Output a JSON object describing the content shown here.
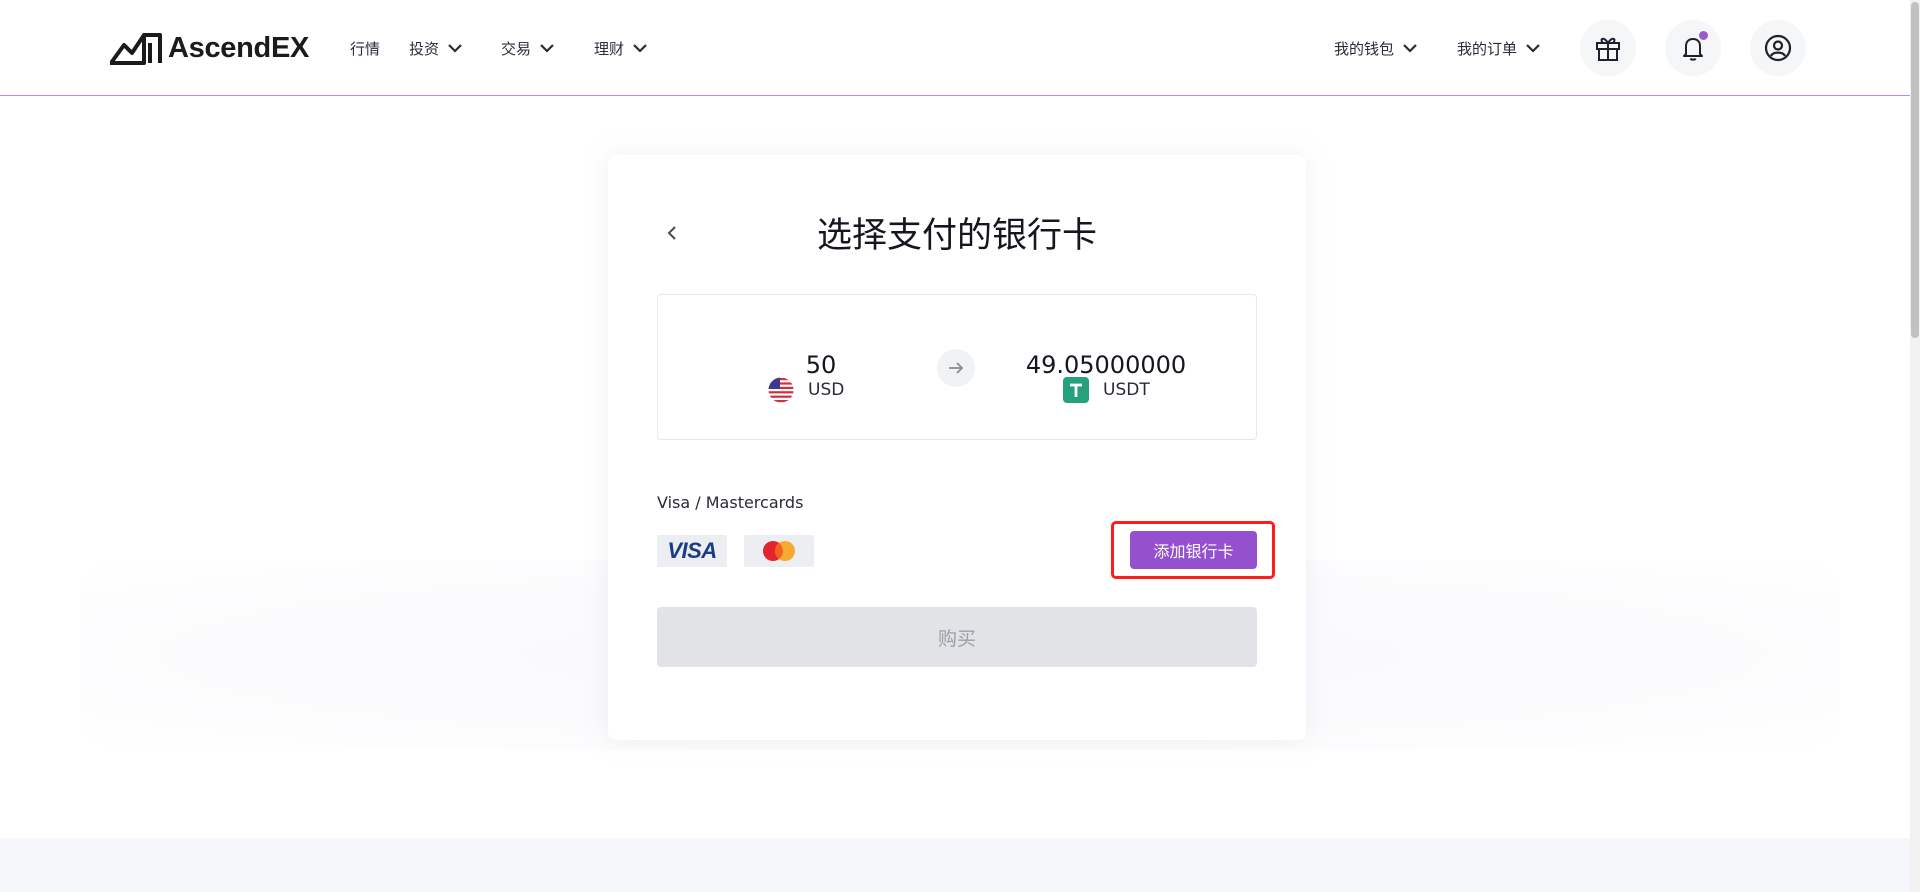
{
  "header": {
    "logo_text": "AscendEX",
    "nav": {
      "market": "行情",
      "invest": "投资",
      "trade": "交易",
      "finance": "理财",
      "wallet": "我的钱包",
      "orders": "我的订单"
    },
    "icons": [
      "gift-icon",
      "bell-icon",
      "user-icon"
    ],
    "notification_dot_color": "#9b59d0"
  },
  "card": {
    "title": "选择支付的银行卡",
    "from": {
      "amount": "50",
      "currency": "USD",
      "icon": "us-flag-icon"
    },
    "to": {
      "amount": "49.05000000",
      "currency": "USDT",
      "icon": "tether-icon"
    },
    "section_label": "Visa / Mastercards",
    "visa_logo_text": "VISA",
    "add_card_label": "添加银行卡",
    "buy_label": "购买"
  },
  "colors": {
    "accent": "#9550cd",
    "highlight": "#ff1c1c",
    "disabled": "#e2e3e6",
    "tether": "#26a17b"
  }
}
